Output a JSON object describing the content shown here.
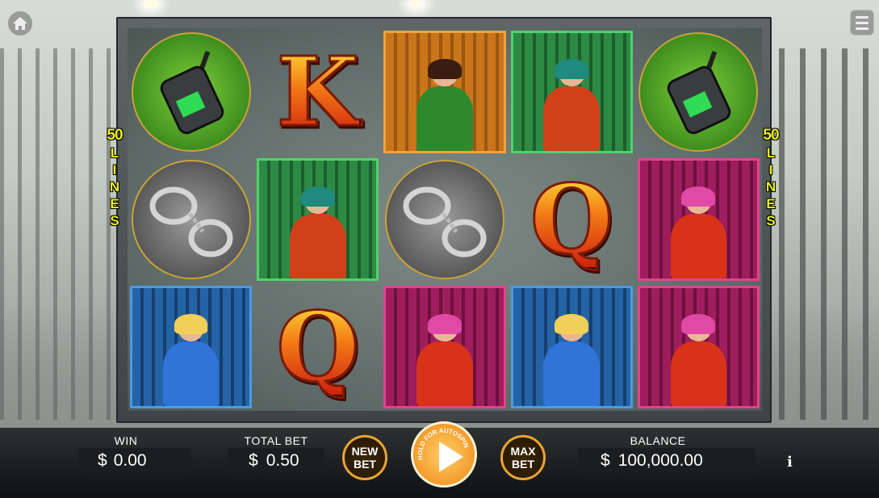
{
  "lines": {
    "count": "50",
    "word": [
      "L",
      "I",
      "N",
      "E",
      "S"
    ]
  },
  "reels": [
    [
      "walkie-talkie",
      "K",
      "maid",
      "dreadlock-woman",
      "walkie-talkie"
    ],
    [
      "handcuffs",
      "dreadlock-woman",
      "handcuffs",
      "Q",
      "money-lady"
    ],
    [
      "officer",
      "Q",
      "money-lady",
      "officer",
      "money-lady"
    ]
  ],
  "hud": {
    "win_label": "WIN",
    "win_currency": "$",
    "win_value": "0.00",
    "total_bet_label": "TOTAL BET",
    "bet_currency": "$",
    "bet_value": "0.50",
    "new_bet_line1": "NEW",
    "new_bet_line2": "BET",
    "max_bet_line1": "MAX",
    "max_bet_line2": "BET",
    "spin_arc_text": "HOLD FOR AUTOSPIN",
    "balance_label": "BALANCE",
    "balance_currency": "$",
    "balance_value": "100,000.00",
    "info_symbol": "i"
  },
  "colors": {
    "lines_text": "#e9f21c",
    "spin_button": "#f6a637",
    "button_border": "#e8a534"
  }
}
